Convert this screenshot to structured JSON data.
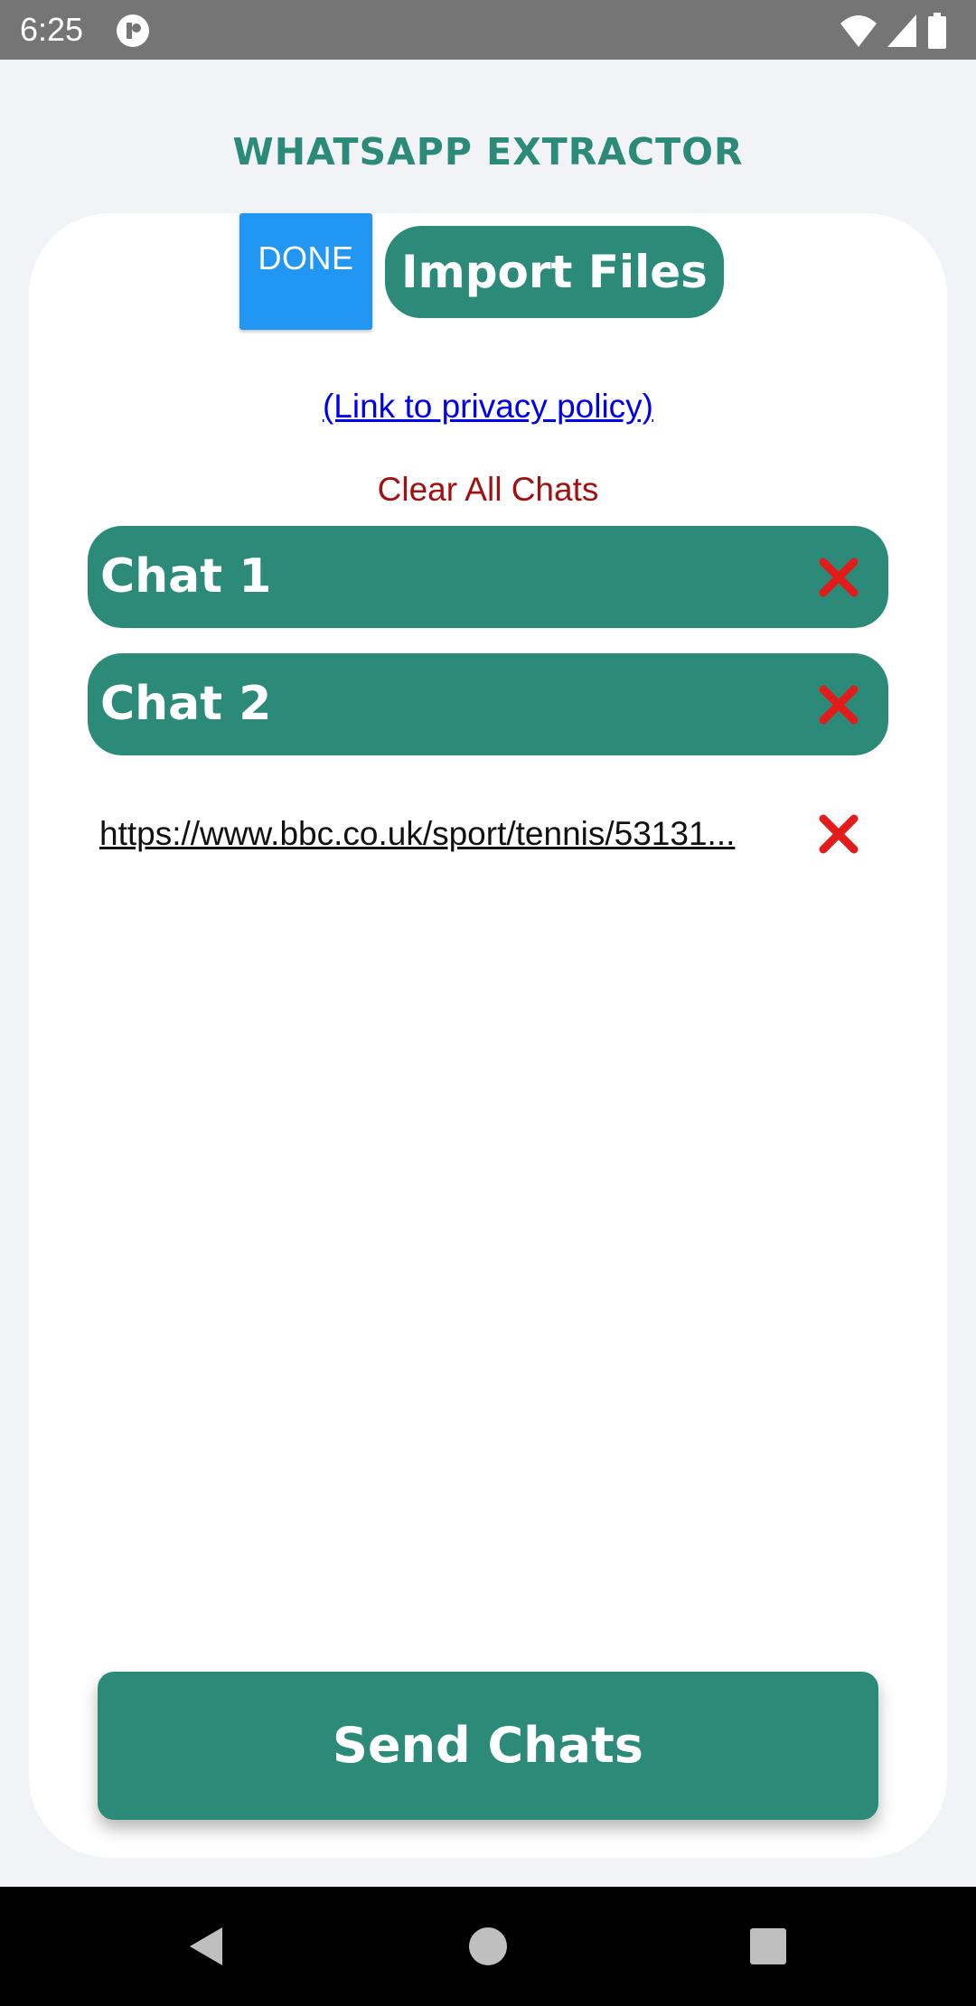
{
  "status_bar": {
    "time": "6:25",
    "icons": [
      "app-notification-icon",
      "wifi-icon",
      "signal-icon",
      "battery-icon"
    ]
  },
  "header": {
    "title": "WHATSAPP EXTRACTOR"
  },
  "toolbar": {
    "done_label": "DONE",
    "import_label": "Import Files"
  },
  "privacy_link": "(Link to privacy policy)",
  "clear_all_label": "Clear All Chats",
  "chats": [
    {
      "name": "Chat 1"
    },
    {
      "name": "Chat 2"
    }
  ],
  "link_item": {
    "text": "https://www.bbc.co.uk/sport/tennis/53131..."
  },
  "send_label": "Send Chats",
  "colors": {
    "accent": "#2b8b78",
    "done_blue": "#2196f3",
    "delete_red": "#e21b1b",
    "clear_red": "#a31010",
    "link_blue": "#0000ee"
  },
  "nav_bar": {
    "icons": [
      "back-icon",
      "home-icon",
      "recents-icon"
    ]
  }
}
